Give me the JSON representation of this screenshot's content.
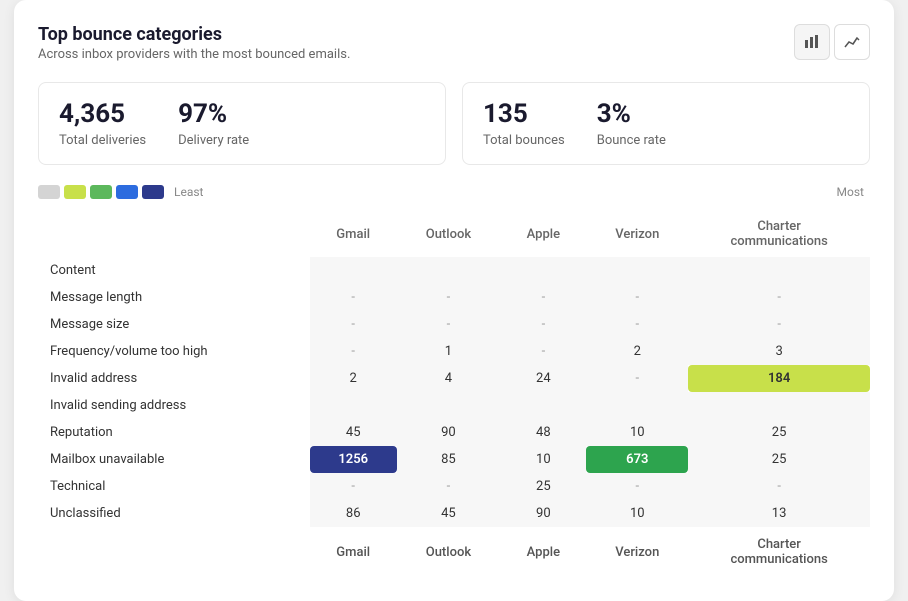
{
  "card": {
    "title": "Top bounce categories",
    "subtitle": "Across inbox providers with the most bounced emails.",
    "chart_bar_label": "bar-chart",
    "chart_line_label": "line-chart"
  },
  "stats": [
    {
      "value": "4,365",
      "label": "Total deliveries",
      "value2": "97%",
      "label2": "Delivery rate"
    },
    {
      "value": "135",
      "label": "Total bounces",
      "value2": "3%",
      "label2": "Bounce rate"
    }
  ],
  "legend": {
    "least_label": "Least",
    "most_label": "Most",
    "colors": [
      "#d4d4d4",
      "#c8e04a",
      "#5cb85c",
      "#2d6cdf",
      "#2d3a8c"
    ]
  },
  "table": {
    "columns": [
      "",
      "Gmail",
      "Outlook",
      "Apple",
      "Verizon",
      "Charter\ncommunications"
    ],
    "rows": [
      {
        "category": "Content",
        "gmail": "",
        "outlook": "",
        "apple": "",
        "verizon": "",
        "charter": ""
      },
      {
        "category": "Message length",
        "gmail": "-",
        "outlook": "-",
        "apple": "-",
        "verizon": "-",
        "charter": "-"
      },
      {
        "category": "Message size",
        "gmail": "-",
        "outlook": "-",
        "apple": "-",
        "verizon": "-",
        "charter": "-"
      },
      {
        "category": "Frequency/volume too high",
        "gmail": "-",
        "outlook": "1",
        "apple": "-",
        "verizon": "2",
        "charter": "3"
      },
      {
        "category": "Invalid address",
        "gmail": "2",
        "outlook": "4",
        "apple": "24",
        "verizon": "-",
        "charter": "184",
        "charter_highlight": "yellow"
      },
      {
        "category": "Invalid sending address",
        "gmail": "",
        "outlook": "",
        "apple": "",
        "verizon": "",
        "charter": ""
      },
      {
        "category": "Reputation",
        "gmail": "45",
        "outlook": "90",
        "apple": "48",
        "verizon": "10",
        "charter": "25"
      },
      {
        "category": "Mailbox unavailable",
        "gmail": "1256",
        "outlook": "85",
        "apple": "10",
        "verizon": "673",
        "charter": "25",
        "gmail_highlight": "blue",
        "verizon_highlight": "green"
      },
      {
        "category": "Technical",
        "gmail": "-",
        "outlook": "-",
        "apple": "25",
        "verizon": "-",
        "charter": "-"
      },
      {
        "category": "Unclassified",
        "gmail": "86",
        "outlook": "45",
        "apple": "90",
        "verizon": "10",
        "charter": "13"
      }
    ]
  }
}
